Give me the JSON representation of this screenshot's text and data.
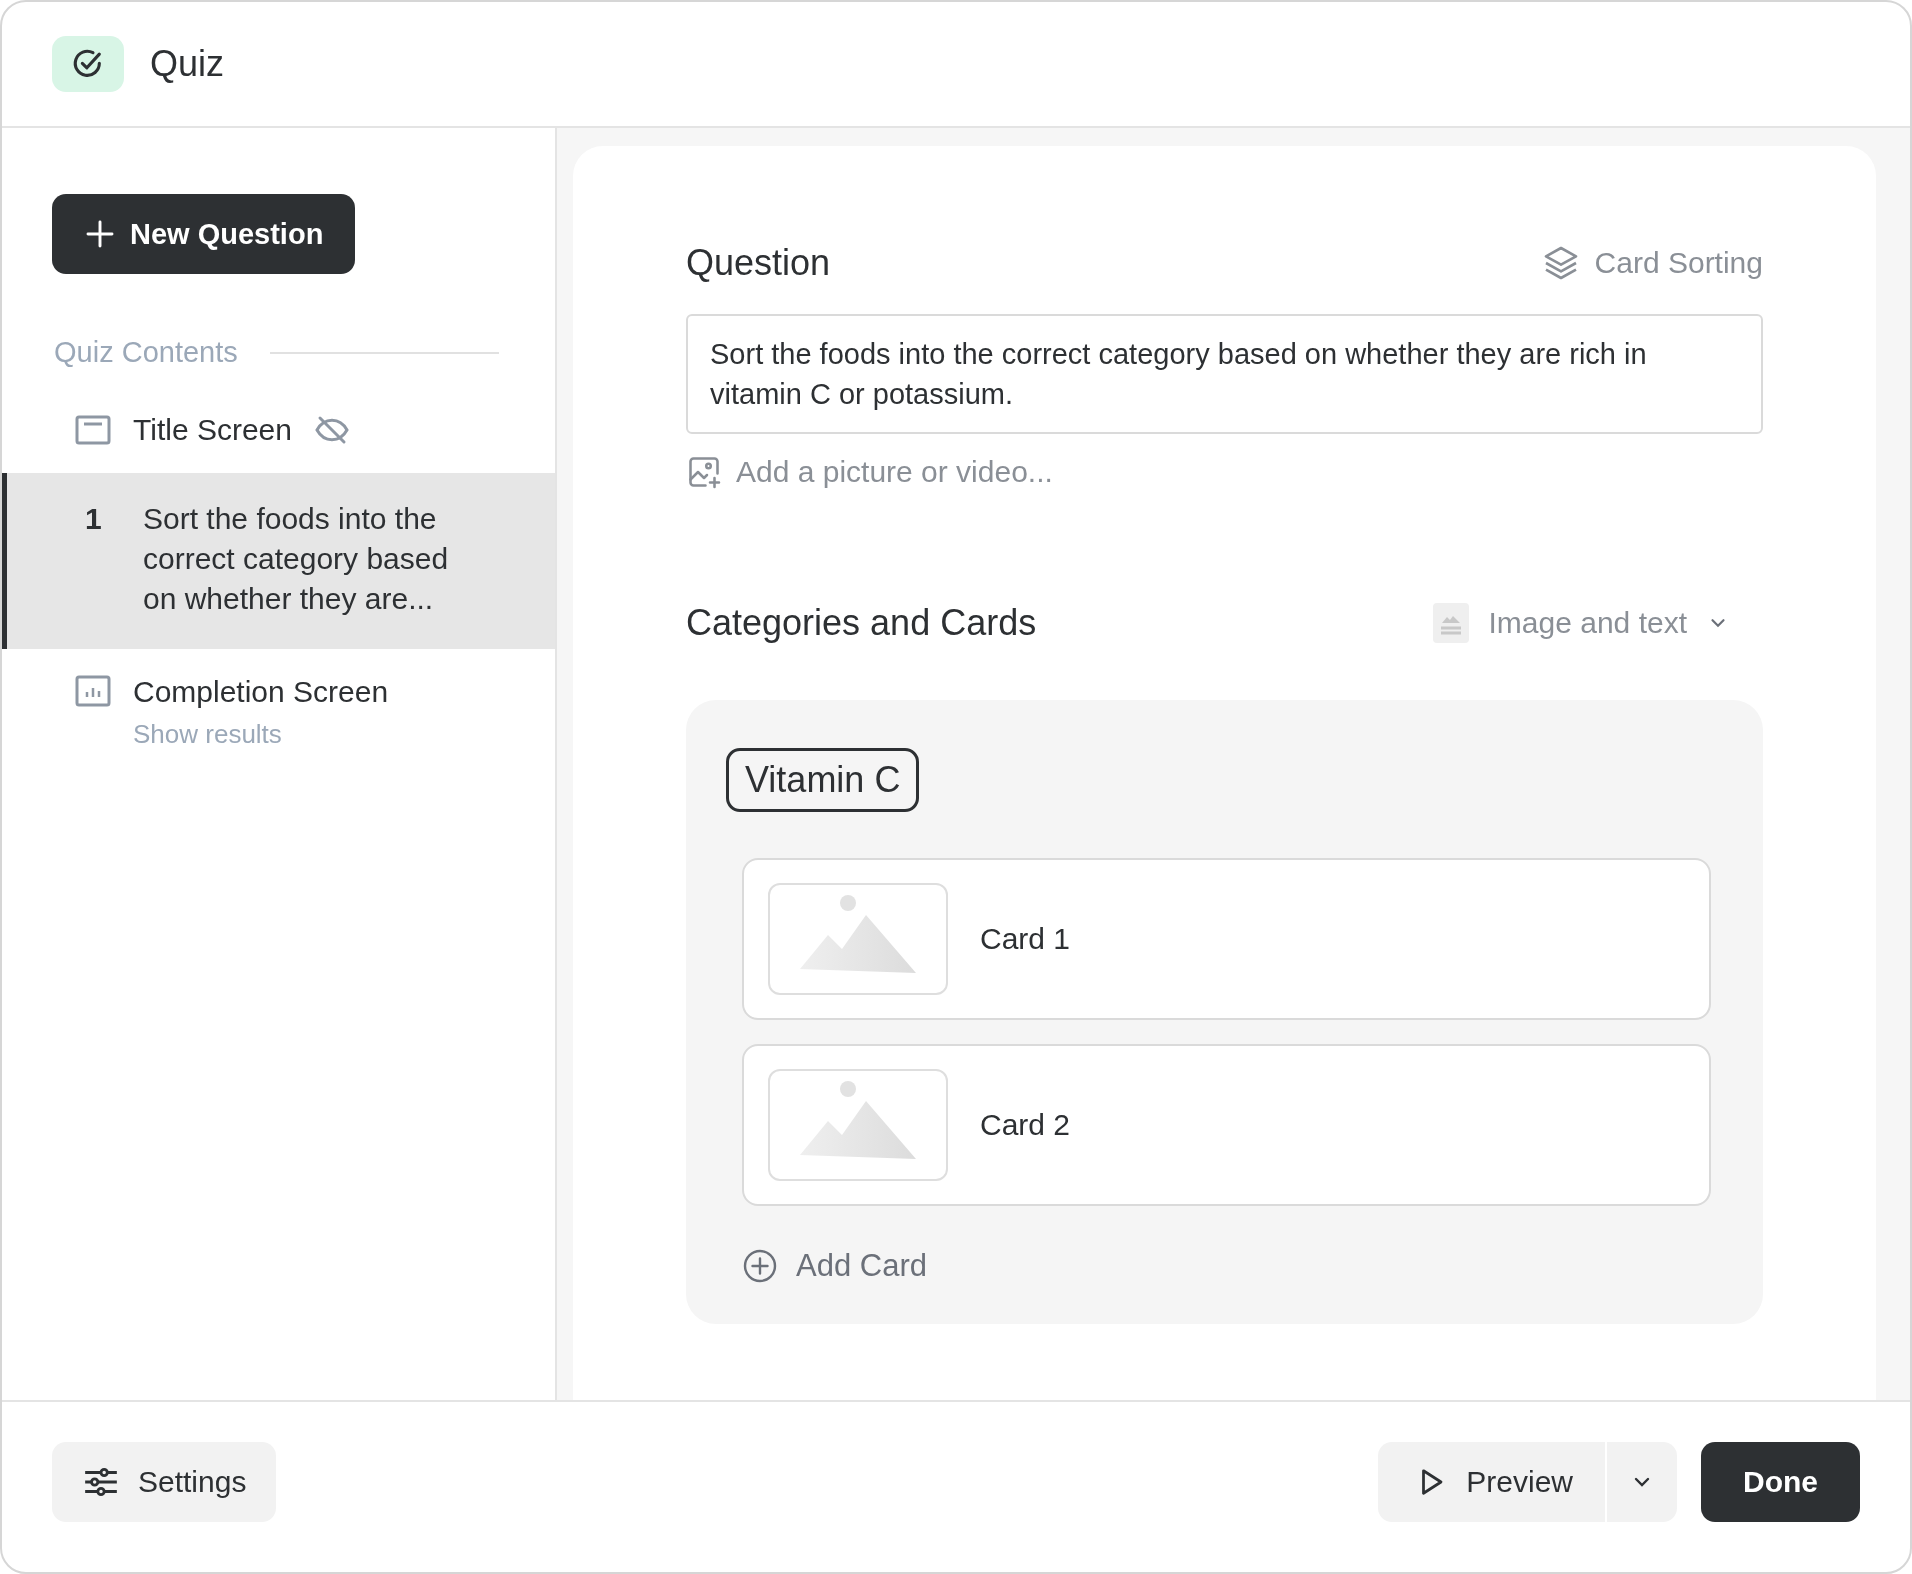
{
  "header": {
    "title": "Quiz"
  },
  "sidebar": {
    "new_button": "New Question",
    "section_label": "Quiz Contents",
    "items": [
      {
        "kind": "title",
        "label": "Title Screen",
        "hidden": true,
        "selected": false
      },
      {
        "kind": "question",
        "number": "1",
        "label": "Sort the foods into the correct category based on whether they are...",
        "selected": true
      },
      {
        "kind": "completion",
        "label": "Completion Screen",
        "sublabel": "Show results",
        "selected": false
      }
    ]
  },
  "editor": {
    "question_heading": "Question",
    "question_type": "Card Sorting",
    "question_text": "Sort the foods into the correct category based on whether they are rich in vitamin C or potassium.",
    "add_media": "Add a picture or video...",
    "categories_heading": "Categories and Cards",
    "card_format": "Image and text",
    "categories": [
      {
        "name": "Vitamin C",
        "cards": [
          {
            "label": "Card 1"
          },
          {
            "label": "Card 2"
          }
        ],
        "add_card": "Add Card"
      }
    ]
  },
  "footer": {
    "settings": "Settings",
    "preview": "Preview",
    "done": "Done"
  }
}
